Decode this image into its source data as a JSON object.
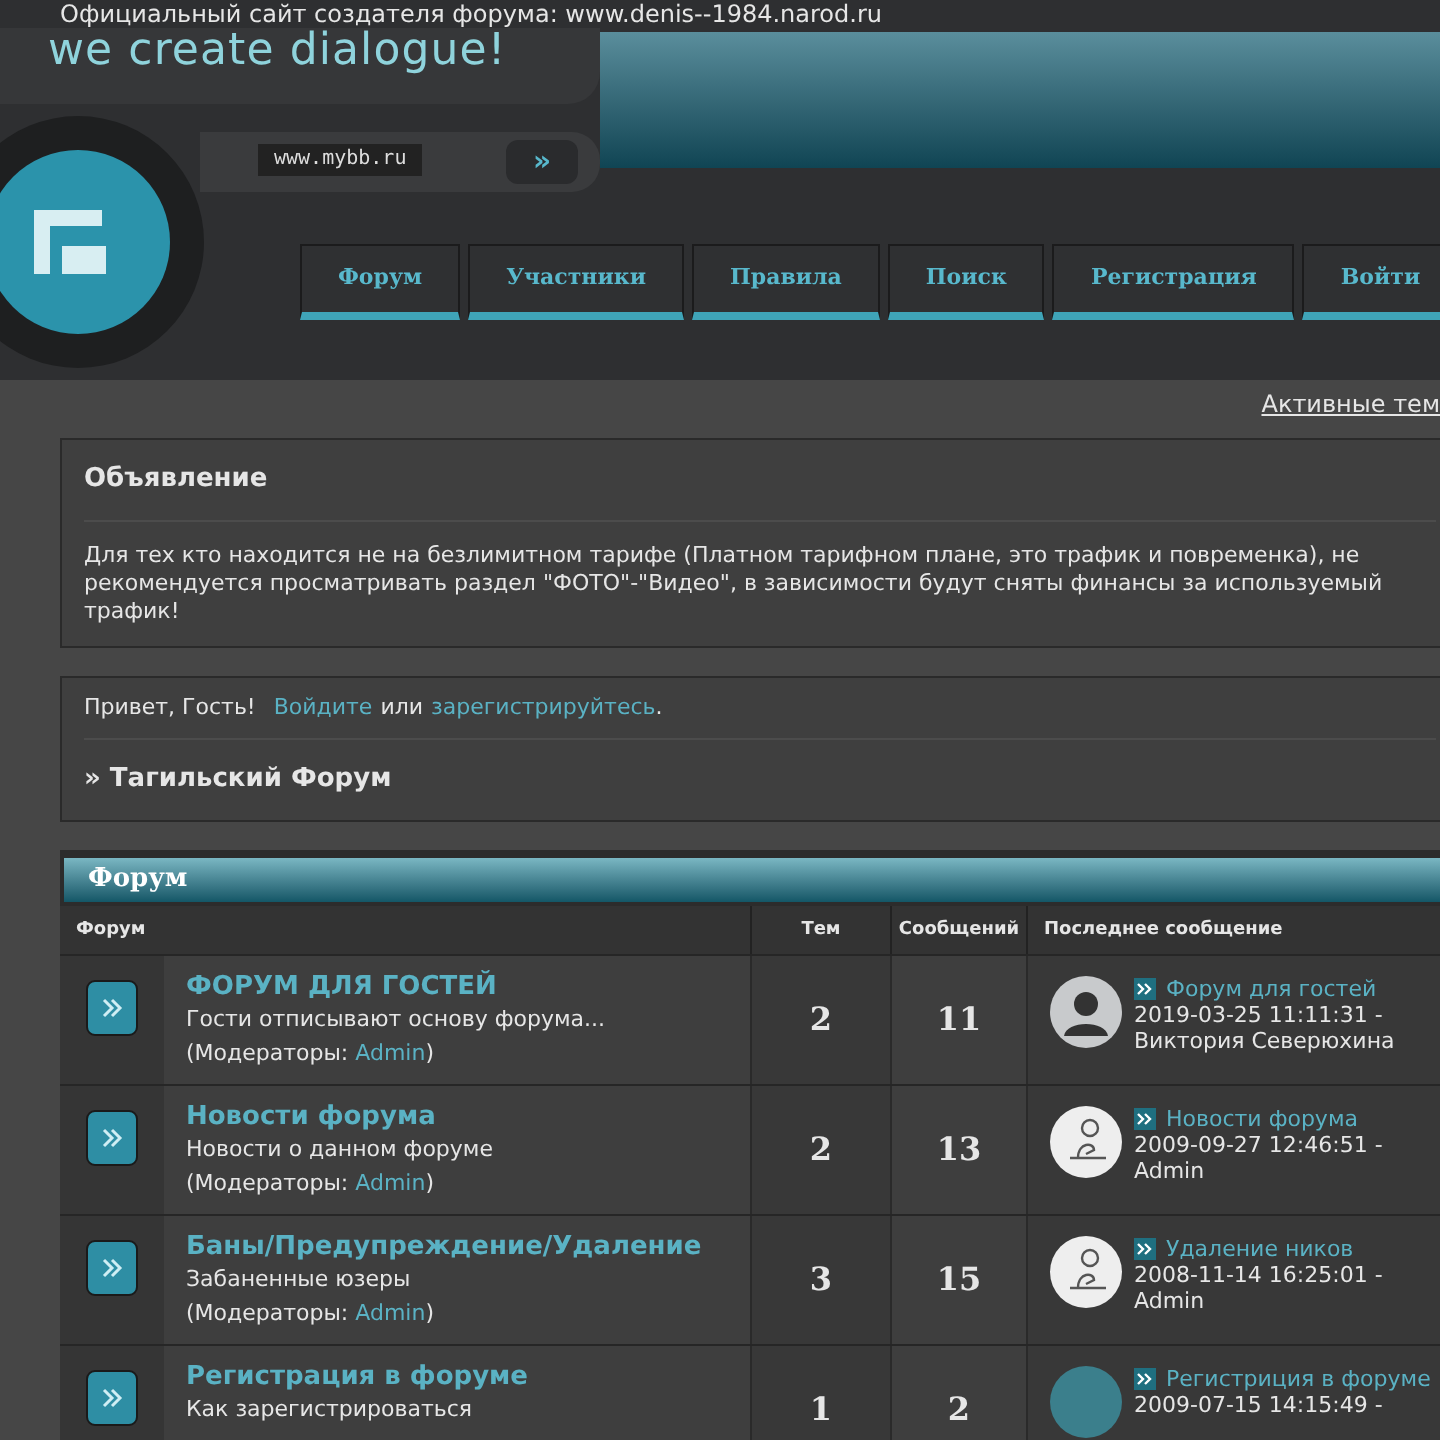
{
  "header": {
    "tagline": "Официальный сайт создателя форума: www.denis--1984.narod.ru",
    "logo_text": "we create dialogue!",
    "url_badge": "www.mybb.ru",
    "go_button": "»"
  },
  "nav": [
    {
      "label": "Форум"
    },
    {
      "label": "Участники"
    },
    {
      "label": "Правила"
    },
    {
      "label": "Поиск"
    },
    {
      "label": "Регистрация"
    },
    {
      "label": "Войти"
    }
  ],
  "active_topics_link": "Активные тем",
  "announcement": {
    "title": "Объявление",
    "text": "Для тех кто находится не на безлимитном тарифе (Платном тарифном плане, это трафик и повременка), не рекомендуется просматривать раздел \"ФОТО\"-\"Видео\", в зависимости будут сняты финансы за используемый трафик!"
  },
  "welcome": {
    "greeting": "Привет, Гость!",
    "login_link": "Войдите",
    "or": "или",
    "register_link": "зарегистрируйтесь",
    "period": ".",
    "breadcrumb": "» Тагильский Форум"
  },
  "forum_section": {
    "title": "Форум",
    "columns": [
      "Форум",
      "Тем",
      "Сообщений",
      "Последнее сообщение"
    ],
    "rows": [
      {
        "name": "ФОРУМ ДЛЯ ГОСТЕЙ",
        "description": "Гости отписывают основу форума...",
        "moderators_label": "(Модераторы: ",
        "moderator": "Admin",
        "moderators_end": ")",
        "topics": "2",
        "posts": "11",
        "avatar": {
          "kind": "silhouette"
        },
        "last_title": "Форум для гостей",
        "last_date": "2019-03-25 11:11:31 -",
        "last_author": "Виктория Северюхина"
      },
      {
        "name": "Новости форума",
        "description": "Новости о данном форуме",
        "moderators_label": "(Модераторы: ",
        "moderator": "Admin",
        "moderators_end": ")",
        "topics": "2",
        "posts": "13",
        "avatar": {
          "kind": "sketch"
        },
        "last_title": "Новости форума",
        "last_date": "2009-09-27 12:46:51 -",
        "last_author": "Admin"
      },
      {
        "name": "Баны/Предупреждение/Удаление",
        "description": "Забаненные юзеры",
        "moderators_label": "(Модераторы: ",
        "moderator": "Admin",
        "moderators_end": ")",
        "topics": "3",
        "posts": "15",
        "avatar": {
          "kind": "sketch"
        },
        "last_title": "Удаление ников",
        "last_date": "2008-11-14 16:25:01 -",
        "last_author": "Admin"
      },
      {
        "name": "Регистрация в форуме",
        "description": "Как зарегистрироваться",
        "topics": "1",
        "posts": "2",
        "avatar": {
          "kind": "photo"
        },
        "last_title": "Регистриция в форуме",
        "last_date": "2009-07-15 14:15:49 -"
      }
    ]
  }
}
